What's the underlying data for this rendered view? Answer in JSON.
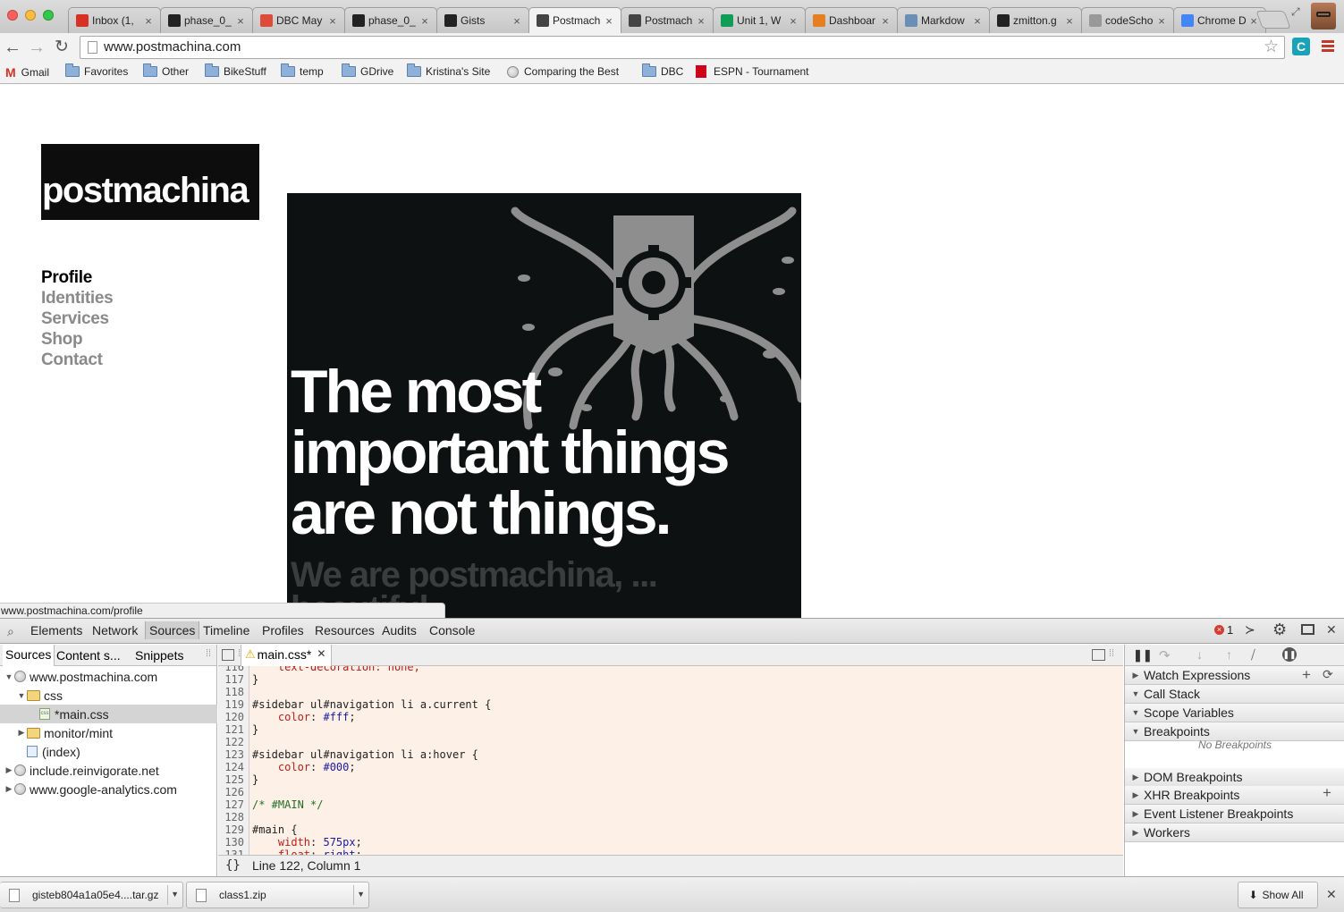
{
  "browser": {
    "tabs": [
      {
        "label": "Inbox (1,",
        "icon": "gmail-icon",
        "color": "#d93025"
      },
      {
        "label": "phase_0_",
        "icon": "github-icon",
        "color": "#222222"
      },
      {
        "label": "DBC May",
        "icon": "google-plus-icon",
        "color": "#dd4b39"
      },
      {
        "label": "phase_0_",
        "icon": "github-icon",
        "color": "#222222"
      },
      {
        "label": "Gists",
        "icon": "github-icon",
        "color": "#222222"
      },
      {
        "label": "Postmach",
        "icon": "postmachina-icon",
        "color": "#444444"
      },
      {
        "label": "Postmach",
        "icon": "postmachina-icon",
        "color": "#444444"
      },
      {
        "label": "Unit 1, W",
        "icon": "sheets-icon",
        "color": "#0f9d58"
      },
      {
        "label": "Dashboar",
        "icon": "code-icon",
        "color": "#e67e22"
      },
      {
        "label": "Markdow",
        "icon": "cloud-icon",
        "color": "#6a8fb5"
      },
      {
        "label": "zmitton.g",
        "icon": "github-icon",
        "color": "#222222"
      },
      {
        "label": "codeScho",
        "icon": "page-icon",
        "color": "#999999"
      },
      {
        "label": "Chrome D",
        "icon": "chrome-icon",
        "color": "#4285f4"
      }
    ],
    "url": "www.postmachina.com",
    "bookmarks": [
      {
        "label": "Gmail",
        "icon": "gmail-icon"
      },
      {
        "label": "Favorites",
        "icon": "folder-icon"
      },
      {
        "label": "Other",
        "icon": "folder-icon"
      },
      {
        "label": "BikeStuff",
        "icon": "folder-icon"
      },
      {
        "label": "temp",
        "icon": "folder-icon"
      },
      {
        "label": "GDrive",
        "icon": "folder-icon"
      },
      {
        "label": "Kristina's Site",
        "icon": "folder-icon"
      },
      {
        "label": "Comparing the Best",
        "icon": "globe-icon"
      },
      {
        "label": "DBC",
        "icon": "folder-icon"
      },
      {
        "label": "ESPN - Tournament",
        "icon": "espn-icon"
      }
    ]
  },
  "site": {
    "logo": "postmachina",
    "logo_mark": "®",
    "nav": [
      "Profile",
      "Identities",
      "Services",
      "Shop",
      "Contact"
    ],
    "current_nav": "Profile",
    "headline": "The most important things are not things.",
    "subline": "We are postmachina, ... beautiful."
  },
  "status_url": "www.postmachina.com/profile",
  "devtools": {
    "tabs": [
      "Elements",
      "Network",
      "Sources",
      "Timeline",
      "Profiles",
      "Resources",
      "Audits",
      "Console"
    ],
    "active_tab": "Sources",
    "error_count": "1",
    "navigator_tabs": [
      "Sources",
      "Content s...",
      "Snippets"
    ],
    "tree": [
      {
        "label": "www.postmachina.com",
        "indent": 0,
        "icon": "globe-icon",
        "expanded": true
      },
      {
        "label": "css",
        "indent": 1,
        "icon": "folder-icon",
        "expanded": true
      },
      {
        "label": "*main.css",
        "indent": 2,
        "icon": "css-file-icon",
        "selected": true
      },
      {
        "label": "monitor/mint",
        "indent": 1,
        "icon": "folder-icon",
        "expanded": false
      },
      {
        "label": "(index)",
        "indent": 1,
        "icon": "document-icon"
      },
      {
        "label": "include.reinvigorate.net",
        "indent": 0,
        "icon": "globe-icon",
        "expanded": false
      },
      {
        "label": "www.google-analytics.com",
        "indent": 0,
        "icon": "globe-icon",
        "expanded": false
      }
    ],
    "editor_tab": "main.css*",
    "code_lines": [
      {
        "n": "116",
        "text": "    text-decoration: none;",
        "kind": "decl"
      },
      {
        "n": "117",
        "text": "}",
        "kind": "plain"
      },
      {
        "n": "118",
        "text": "",
        "kind": "plain"
      },
      {
        "n": "119",
        "text": "#sidebar ul#navigation li a.current {",
        "kind": "plain"
      },
      {
        "n": "120",
        "prop": "color",
        "value": "#fff",
        "kind": "pv"
      },
      {
        "n": "121",
        "text": "}",
        "kind": "plain"
      },
      {
        "n": "122",
        "text": "",
        "kind": "plain"
      },
      {
        "n": "123",
        "text": "#sidebar ul#navigation li a:hover {",
        "kind": "plain"
      },
      {
        "n": "124",
        "prop": "color",
        "value": "#000",
        "kind": "pv"
      },
      {
        "n": "125",
        "text": "}",
        "kind": "plain"
      },
      {
        "n": "126",
        "text": "",
        "kind": "plain"
      },
      {
        "n": "127",
        "text": "/* #MAIN */",
        "kind": "comment"
      },
      {
        "n": "128",
        "text": "",
        "kind": "plain"
      },
      {
        "n": "129",
        "text": "#main {",
        "kind": "plain"
      },
      {
        "n": "130",
        "prop": "width",
        "value": "575px",
        "kind": "pv"
      },
      {
        "n": "131",
        "prop": "float",
        "value": "right",
        "kind": "pv"
      }
    ],
    "cursor_status": "Line 122, Column 1",
    "right_panes": [
      {
        "label": "Watch Expressions",
        "expanded": false
      },
      {
        "label": "Call Stack",
        "expanded": true
      },
      {
        "label": "Scope Variables",
        "expanded": true
      },
      {
        "label": "Breakpoints",
        "expanded": true
      },
      {
        "label": "DOM Breakpoints",
        "expanded": false
      },
      {
        "label": "XHR Breakpoints",
        "expanded": false
      },
      {
        "label": "Event Listener Breakpoints",
        "expanded": false
      },
      {
        "label": "Workers",
        "expanded": false
      }
    ],
    "no_breakpoints": "No Breakpoints"
  },
  "downloads": {
    "items": [
      "gisteb804a1a05e4....tar.gz",
      "class1.zip"
    ],
    "show_all": "Show All"
  }
}
